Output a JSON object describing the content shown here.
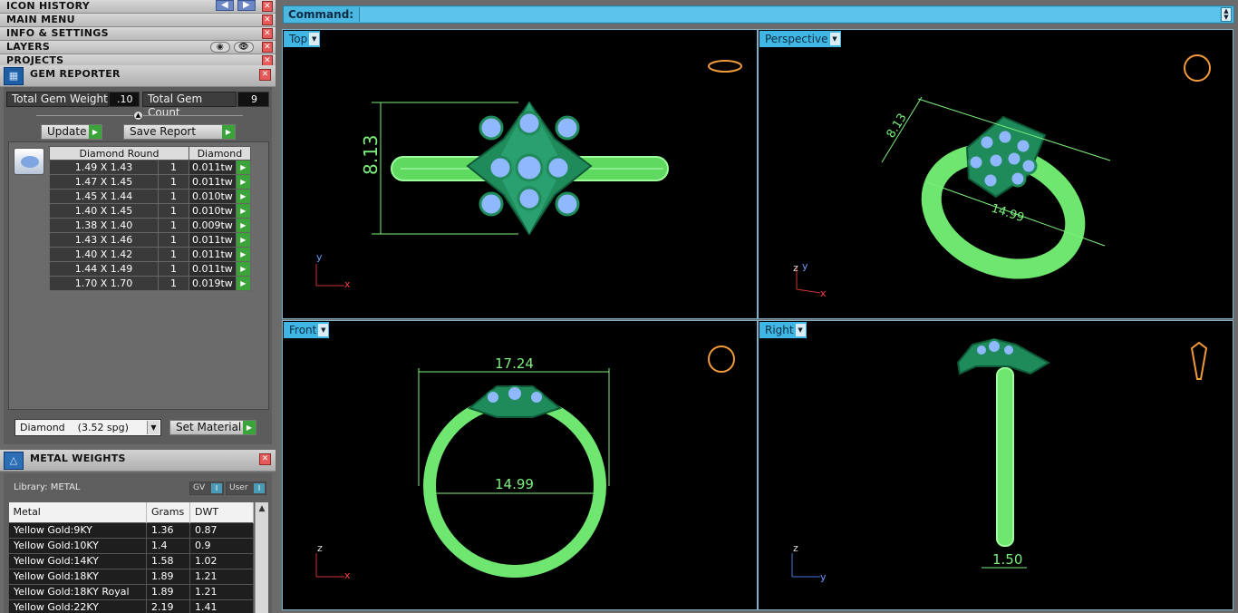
{
  "left_menus": {
    "icon_history": "ICON HISTORY",
    "main_menu": "MAIN MENU",
    "info_settings": "INFO & SETTINGS",
    "layers": "LAYERS",
    "projects": "PROJECTS"
  },
  "gem_reporter": {
    "title": "GEM REPORTER",
    "total_weight_label": "Total Gem Weight",
    "total_weight_value": ".10",
    "total_count_label": "Total Gem Count",
    "total_count_value": "9",
    "update_label": "Update",
    "save_report_label": "Save Report",
    "col_shape": "Diamond Round",
    "col_material": "Diamond",
    "rows": [
      {
        "size": "1.49 X 1.43",
        "count": "1",
        "tw": "0.011tw"
      },
      {
        "size": "1.47 X 1.45",
        "count": "1",
        "tw": "0.011tw"
      },
      {
        "size": "1.45 X 1.44",
        "count": "1",
        "tw": "0.010tw"
      },
      {
        "size": "1.40 X 1.45",
        "count": "1",
        "tw": "0.010tw"
      },
      {
        "size": "1.38 X 1.40",
        "count": "1",
        "tw": "0.009tw"
      },
      {
        "size": "1.43 X 1.46",
        "count": "1",
        "tw": "0.011tw"
      },
      {
        "size": "1.40 X 1.42",
        "count": "1",
        "tw": "0.011tw"
      },
      {
        "size": "1.44 X 1.49",
        "count": "1",
        "tw": "0.011tw"
      },
      {
        "size": "1.70 X 1.70",
        "count": "1",
        "tw": "0.019tw"
      }
    ],
    "material_select": "Diamond    (3.52 spg)",
    "set_material_label": "Set Material"
  },
  "metal_weights": {
    "title": "METAL WEIGHTS",
    "library": "Library: METAL",
    "gv_label": "GV",
    "user_label": "User",
    "col_metal": "Metal",
    "col_grams": "Grams",
    "col_dwt": "DWT",
    "rows": [
      {
        "metal": "Yellow Gold:9KY",
        "grams": "1.36",
        "dwt": "0.87"
      },
      {
        "metal": "Yellow Gold:10KY",
        "grams": "1.4",
        "dwt": "0.9"
      },
      {
        "metal": "Yellow Gold:14KY",
        "grams": "1.58",
        "dwt": "1.02"
      },
      {
        "metal": "Yellow Gold:18KY",
        "grams": "1.89",
        "dwt": "1.21"
      },
      {
        "metal": "Yellow Gold:18KY Royal",
        "grams": "1.89",
        "dwt": "1.21"
      },
      {
        "metal": "Yellow Gold:22KY",
        "grams": "2.19",
        "dwt": "1.41"
      }
    ]
  },
  "command": {
    "label": "Command:"
  },
  "viewports": {
    "top": {
      "name": "Top",
      "dim": "8.13",
      "axis_y": "y",
      "axis_x": "x"
    },
    "perspective": {
      "name": "Perspective",
      "dim_a": "8.13",
      "dim_b": "14.99",
      "axis_z": "z",
      "axis_y": "y",
      "axis_x": "x"
    },
    "front": {
      "name": "Front",
      "dim_a": "17.24",
      "dim_b": "14.99",
      "axis_z": "z",
      "axis_x": "x"
    },
    "right": {
      "name": "Right",
      "dim": "1.50",
      "axis_z": "z",
      "axis_y": "y"
    }
  },
  "colors": {
    "ring_green": "#7cf07c",
    "setting_green": "#1f8a5a",
    "gem_blue": "#8fb8ff",
    "cmd_blue": "#4ab8e0",
    "close_red": "#e85a5a"
  }
}
